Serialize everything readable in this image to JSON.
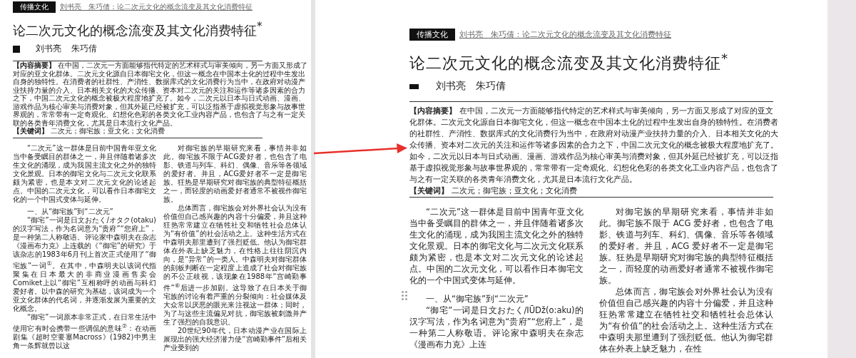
{
  "source_page": {
    "header_tag": "传播文化",
    "running_head": "刘书亮　朱巧倩：论二次元文化的概念流变及其文化消费特征",
    "title": "论二次元文化的概念流变及其文化消费特征$^{*}$",
    "authors": [
      "刘书亮",
      "朱巧倩"
    ],
    "abstract_label": "【内容摘要】",
    "abstract": "在中国，二次元一方面能够指代特定的艺术样式与审美倾向，另一方面又形成了对应的亚文化群体。二次元文化源自日本御宅文化，但这一概念在中国本土化的过程中生发出自身的独特性。在消费者的社群性、产消性、数据库式的文化消费行为当中，在政府对动漫产业扶持力量的介入、日本相关文化的大众传播、资本对二次元的关注和运作等诸多因素的合力之下，中国二次元文化的概念被极大程度地扩充了。如今，二次元以日本与日式动画、漫画、游戏作品为核心审美与消费对象，但其外延已经被扩充，可以泛指基于虚拟视觉形象与故事世界观的，常常带有一定奇观化、幻想化色彩的各类文化工业内容产品，也包含了与之有一定关联的各类青年消费文化，尤其是日本流行文化产品。",
    "keywords_label": "【关键词】",
    "keywords": "二次元；御宅族；亚文化；文化消费",
    "columns": [
      [
        {
          "kind": "paragraph",
          "text": "“二次元”这一群体是目前中国青年亚文化当中备受瞩目的群体之一，并且伴随着诸多次生文化的涌现，成为我国主流文化之外的独特文化景观。日本的御宅文化与二次元文化联系颇为紧密，也是本文对二次元文化的论述起点。中国的二次元文化，可以看作日本御宅文化的一个中国式变体与延伸。"
        },
        {
          "kind": "heading",
          "text": "一、从“御宅族”到“二次元”"
        },
        {
          "kind": "paragraph",
          "text": "“御宅”一词是日文おたく/オタク(otaku)的汉字写法，作为名词意为“贵府”“您府上”，是一种第二人称敬语。评论家中森明夫在杂志《漫画布力克》上连载的《“御宅”的研究》于该杂志的1983年6月刊上首次正式使用了“御宅族”一词$^{①}$。在其中，中森明夫以该词代指聚集在日本最大的非商业漫画售卖会Comiket上以“御宅”互相称呼的动画与科幻爱好者。以中森的研究为基础，该词成为一个亚文化群体的代名词，并逐渐发展为重要的文化概念。"
        },
        {
          "kind": "paragraph",
          "text": "“御宅”一词原本非常正式，在日常生活中使用它有时会携带一些调侃的意味$^{②}$：在动画剧集《超时空要塞Macross》(1982)中男主角一条辉就曾以这"
        }
      ],
      [
        {
          "kind": "paragraph",
          "text": "对御宅族的早期研究来看，事情并非如此。御宅族不限于ACG爱好者，也包含了电影、铁道与列车、科幻、偶像、音乐等各领域的爱好者。并且，ACG爱好者不一定是御宅族。狂热是早期研究对御宅族的典型特征概括之一，而轻度的动画爱好者通常不被视作御宅族。"
        },
        {
          "kind": "paragraph",
          "text": "总体而言，御宅族会对外界社会认为没有价值但自己感兴趣的内容十分偏爱，并且这种狂热常常建立在牺牲社交和牺牲社会总体认为“有价值”的社会活动之上。这种生活方式在中森明夫那里遭到了强烈贬低。他认为御宅群体在外表上缺乏魅力，在性格上往往阴沉内向，是“异常”的一类人。中森明夫对御宅群体的刻板判断在一定程度上造成了社会对御宅族的不公正歧视，该现象在1988年“宫崎勤事件”$^{⑥}$后进一步加剧。这导致了在日本关于御宅族的讨论有着严重的分裂倾向：社会媒体及大众常以厌恶的眼光来注视这一群体；同时，为了与这些主流偏见对抗，御宅族被刺激并产生了强烈的自我意识。"
        },
        {
          "kind": "paragraph",
          "text": "20世纪90年代，日本动漫产业在国际上展现出的强大经济潜力使“宫崎勤事件”后相关产业受到的"
        }
      ]
    ]
  },
  "editor_page": {
    "header_tag": "传播文化",
    "running_head": "刘书亮　朱巧倩：论二次元文化的概念流变及其文化消费特征",
    "title": "论二次元文化的概念流变及其文化消费特征$^{*}$",
    "authors": [
      "刘书亮",
      "朱巧倩"
    ],
    "abstract_label": "【内容摘要】",
    "abstract": "在中国，二次元一方面能够指代特定的艺术样式与审美倾向，另一方面又形成了对应的亚文化群体。二次元文化源自日本御宅文化，但这一概念在中国本土化的过程中生发出自身的独特性。在消费者的社群性、产消性、数据库式的文化消费行为当中，在政府对动漫产业扶持力量的介入、日本相关文化的大众传播、资本对二次元的关注和运作等诸多因素的合力之下，中国二次元文化的概念被极大程度地扩充了。如今，二次元以日本与日式动画、漫画、游戏作品为核心审美与消费对象，但其外延已经被扩充，可以泛指基于虚拟视觉形象与故事世界观的，常常带有一定奇观化、幻想化色彩的各类文化工业内容产品，也包含了与之有一定关联的各类青年消费文化，尤其是日本流行文化产品。",
    "keywords_label": "【关键词】",
    "keywords": "二次元；御宅族；亚文化；文化消费",
    "columns": [
      [
        {
          "kind": "paragraph",
          "text": "“二次元”这一群体是目前中国青年亚文化当中备受瞩目的群体之一，并且伴随着诸多次生文化的涌现，成为我国主流文化之外的独特文化景观。日本的御宅文化与二次元文化联系颇为紧密，也是本文对二次元文化的论述起点。中国的二次元文化，可以看作日本御宅文化的一个中国式变体与延伸。"
        },
        {
          "kind": "heading",
          "text": "一、从“御宅族”到“二次元”"
        },
        {
          "kind": "paragraph",
          "text": "“御宅”一词是日文おたく/IŪDž(o:aku)的汉字写法，作为名词意为“贵府”“您府上”，是一种第二人称敬语。评论家中森明夫在杂志《漫画布力克》上连"
        }
      ],
      [
        {
          "kind": "paragraph",
          "text": "对御宅族的早期研究来看，事情并非如此。御宅族不限于 ACG 爱好者，也包含了电影、铁道与列车、科幻、偶像、音乐等各领域的爱好者。并且，ACG 爱好者不一定是御宅族。狂热是早期研究对御宅族的典型特征概括之一，而轻度的动画爱好者通常不被视作御宅族。"
        },
        {
          "kind": "paragraph",
          "text": "总体而言，御宅族会对外界社会认为没有价值但自己感兴趣的内容十分偏爱，并且这种狂热常常建立在牺牲社交和牺牲社会总体认为“有价值”的社会活动之上。这种生活方式在中森明夫那里遭到了强烈贬低。他认为御宅群体在外表上缺乏魅力，在性"
        }
      ]
    ]
  }
}
